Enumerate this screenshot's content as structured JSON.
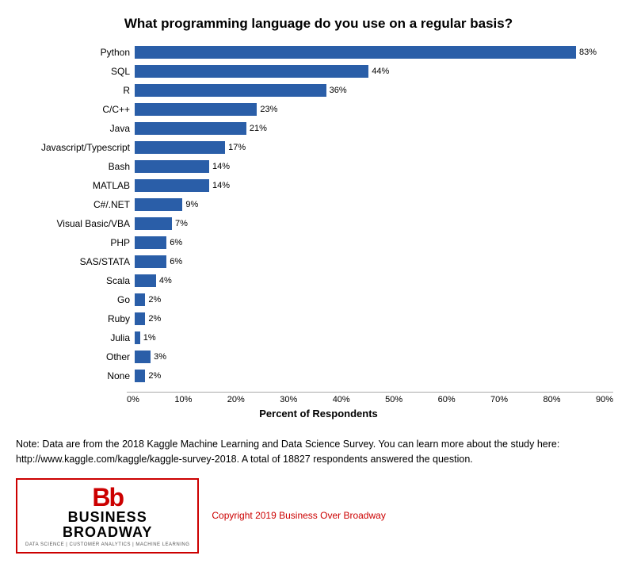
{
  "title": "What programming language do you use on a regular basis?",
  "bars": [
    {
      "label": "Python",
      "value": 83,
      "display": "83%"
    },
    {
      "label": "SQL",
      "value": 44,
      "display": "44%"
    },
    {
      "label": "R",
      "value": 36,
      "display": "36%"
    },
    {
      "label": "C/C++",
      "value": 23,
      "display": "23%"
    },
    {
      "label": "Java",
      "value": 21,
      "display": "21%"
    },
    {
      "label": "Javascript/Typescript",
      "value": 17,
      "display": "17%"
    },
    {
      "label": "Bash",
      "value": 14,
      "display": "14%"
    },
    {
      "label": "MATLAB",
      "value": 14,
      "display": "14%"
    },
    {
      "label": "C#/.NET",
      "value": 9,
      "display": "9%"
    },
    {
      "label": "Visual Basic/VBA",
      "value": 7,
      "display": "7%"
    },
    {
      "label": "PHP",
      "value": 6,
      "display": "6%"
    },
    {
      "label": "SAS/STATA",
      "value": 6,
      "display": "6%"
    },
    {
      "label": "Scala",
      "value": 4,
      "display": "4%"
    },
    {
      "label": "Go",
      "value": 2,
      "display": "2%"
    },
    {
      "label": "Ruby",
      "value": 2,
      "display": "2%"
    },
    {
      "label": "Julia",
      "value": 1,
      "display": "1%"
    },
    {
      "label": "Other",
      "value": 3,
      "display": "3%"
    },
    {
      "label": "None",
      "value": 2,
      "display": "2%"
    }
  ],
  "x_axis": {
    "labels": [
      "0%",
      "10%",
      "20%",
      "30%",
      "40%",
      "50%",
      "60%",
      "70%",
      "80%",
      "90%"
    ],
    "max": 90,
    "title": "Percent of Respondents"
  },
  "note": "Note: Data are from the 2018 Kaggle Machine Learning and Data Science Survey. You can learn more about the study here: http://www.kaggle.com/kaggle/kaggle-survey-2018.  A total of 18827 respondents answered the question.",
  "logo": {
    "bb": "Bb",
    "business": "BUSINESS",
    "broadway": "BROADWAY",
    "tagline": "DATA SCIENCE | CUSTOMER ANALYTICS | MACHINE LEARNING"
  },
  "copyright": "Copyright 2019 Business Over Broadway"
}
